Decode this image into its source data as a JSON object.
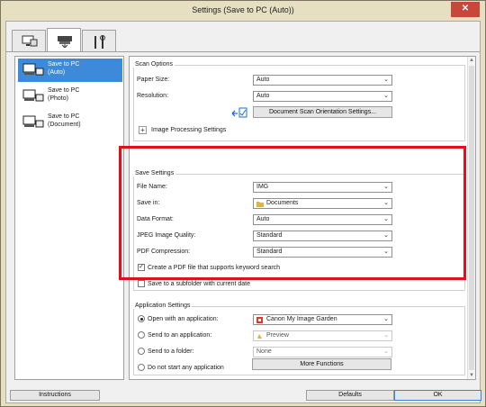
{
  "window": {
    "title": "Settings (Save to PC (Auto))",
    "close_glyph": "✕"
  },
  "tabs": [
    {
      "name": "scan-from-computer",
      "icon": "computer-icon"
    },
    {
      "name": "scan-from-operation-panel",
      "icon": "scanner-icon",
      "active": true
    },
    {
      "name": "general-settings",
      "icon": "tools-icon"
    }
  ],
  "sidebar": {
    "items": [
      {
        "label_line1": "Save to PC",
        "label_line2": "(Auto)",
        "selected": true,
        "icon": "scanner-pc-icon"
      },
      {
        "label_line1": "Save to PC",
        "label_line2": "(Photo)",
        "selected": false,
        "icon": "scanner-pc-icon"
      },
      {
        "label_line1": "Save to PC",
        "label_line2": "(Document)",
        "selected": false,
        "icon": "scanner-pc-icon"
      }
    ]
  },
  "scan_options": {
    "title": "Scan Options",
    "paper_size": {
      "label": "Paper Size:",
      "value": "Auto"
    },
    "resolution": {
      "label": "Resolution:",
      "value": "Auto"
    },
    "orientation_button": "Document Scan Orientation Settings...",
    "image_processing": {
      "label": "Image Processing Settings",
      "expander": "+"
    }
  },
  "save_settings": {
    "title": "Save Settings",
    "file_name": {
      "label": "File Name:",
      "value": "IMG"
    },
    "save_in": {
      "label": "Save in:",
      "value": "Documents"
    },
    "data_format": {
      "label": "Data Format:",
      "value": "Auto"
    },
    "jpeg_quality": {
      "label": "JPEG Image Quality:",
      "value": "Standard"
    },
    "pdf_compression": {
      "label": "PDF Compression:",
      "value": "Standard"
    },
    "keyword_pdf": {
      "label": "Create a PDF file that supports keyword search",
      "checked": true
    },
    "subfolder": {
      "label": "Save to a subfolder with current date",
      "checked": false
    }
  },
  "application_settings": {
    "title": "Application Settings",
    "open_with": {
      "label": "Open with an application:",
      "value": "Canon My Image Garden",
      "selected": true
    },
    "send_to_app": {
      "label": "Send to an application:",
      "value": "Preview",
      "selected": false
    },
    "send_to_folder": {
      "label": "Send to a folder:",
      "value": "None",
      "selected": false
    },
    "do_not_start": {
      "label": "Do not start any application",
      "selected": false
    },
    "more_functions": "More Functions"
  },
  "footer": {
    "instructions": "Instructions",
    "defaults": "Defaults",
    "ok": "OK"
  },
  "glyphs": {
    "dropdown": "⌄",
    "check": "✓",
    "scroll_up": "▲",
    "scroll_down": "▼"
  },
  "colors": {
    "highlight_frame": "#e0101f",
    "selection": "#3c8ad9"
  }
}
